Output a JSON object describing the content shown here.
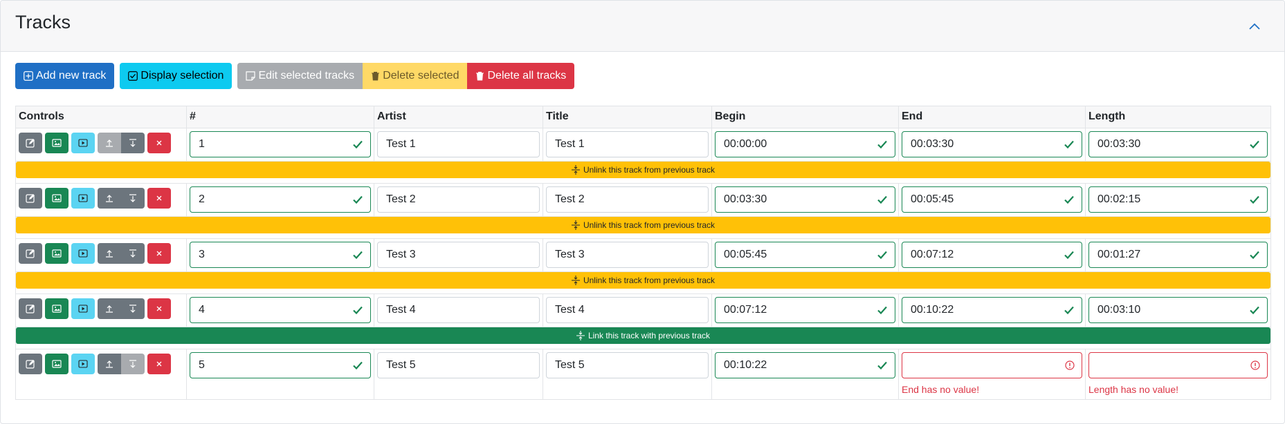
{
  "header": {
    "title": "Tracks"
  },
  "toolbar": {
    "add_label": "Add new track",
    "display_label": "Display selection",
    "edit_label": "Edit selected tracks",
    "delete_selected_label": "Delete selected",
    "delete_all_label": "Delete all tracks"
  },
  "table": {
    "columns": [
      "Controls",
      "#",
      "Artist",
      "Title",
      "Begin",
      "End",
      "Length"
    ]
  },
  "tracks": [
    {
      "number": "1",
      "artist": "Test 1",
      "title": "Test 1",
      "begin": "00:00:00",
      "end": "00:03:30",
      "length": "00:03:30"
    },
    {
      "number": "2",
      "artist": "Test 2",
      "title": "Test 2",
      "begin": "00:03:30",
      "end": "00:05:45",
      "length": "00:02:15"
    },
    {
      "number": "3",
      "artist": "Test 3",
      "title": "Test 3",
      "begin": "00:05:45",
      "end": "00:07:12",
      "length": "00:01:27"
    },
    {
      "number": "4",
      "artist": "Test 4",
      "title": "Test 4",
      "begin": "00:07:12",
      "end": "00:10:22",
      "length": "00:03:10"
    },
    {
      "number": "5",
      "artist": "Test 5",
      "title": "Test 5",
      "begin": "00:10:22",
      "end": "",
      "length": "",
      "end_error": "End has no value!",
      "length_error": "Length has no value!"
    }
  ],
  "links": {
    "unlink_label": "Unlink this track from previous track",
    "link_label": "Link this track with previous track"
  },
  "colors": {
    "primary": "#1f6fc5",
    "info": "#0dcaf0",
    "success": "#198754",
    "warning": "#ffc107",
    "danger": "#dc3545",
    "secondary": "#6c757d"
  }
}
